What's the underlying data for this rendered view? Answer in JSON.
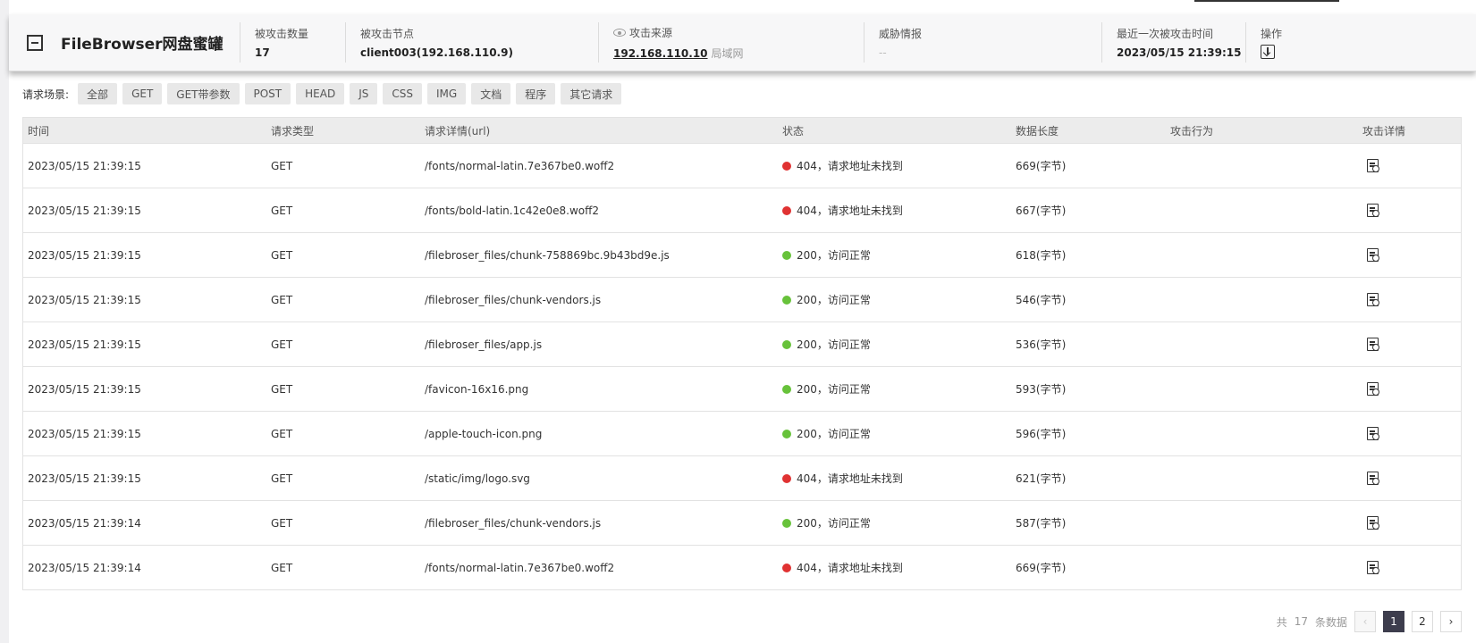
{
  "header": {
    "title": "FileBrowser网盘蜜罐",
    "stats": [
      {
        "label": "被攻击数量",
        "value": "17"
      },
      {
        "label": "被攻击节点",
        "value": "client003(192.168.110.9)"
      },
      {
        "label": "攻击来源",
        "value": "192.168.110.10",
        "extra": "局域网"
      },
      {
        "label": "威胁情报",
        "value": "--"
      },
      {
        "label": "最近一次被攻击时间",
        "value": "2023/05/15 21:39:15"
      },
      {
        "label": "操作"
      }
    ]
  },
  "filters": {
    "label": "请求场景:",
    "options": [
      "全部",
      "GET",
      "GET带参数",
      "POST",
      "HEAD",
      "JS",
      "CSS",
      "IMG",
      "文档",
      "程序",
      "其它请求"
    ]
  },
  "table": {
    "columns": [
      "时间",
      "请求类型",
      "请求详情(url)",
      "状态",
      "数据长度",
      "攻击行为",
      "攻击详情"
    ],
    "status_colors": {
      "error": "#e03232",
      "ok": "#67c23a"
    },
    "rows": [
      {
        "time": "2023/05/15 21:39:15",
        "method": "GET",
        "url": "/fonts/normal-latin.7e367be0.woff2",
        "status": "404，请求地址未找到",
        "status_type": "error",
        "length": "669(字节)",
        "behavior": ""
      },
      {
        "time": "2023/05/15 21:39:15",
        "method": "GET",
        "url": "/fonts/bold-latin.1c42e0e8.woff2",
        "status": "404，请求地址未找到",
        "status_type": "error",
        "length": "667(字节)",
        "behavior": ""
      },
      {
        "time": "2023/05/15 21:39:15",
        "method": "GET",
        "url": "/filebroser_files/chunk-758869bc.9b43bd9e.js",
        "status": "200，访问正常",
        "status_type": "ok",
        "length": "618(字节)",
        "behavior": ""
      },
      {
        "time": "2023/05/15 21:39:15",
        "method": "GET",
        "url": "/filebroser_files/chunk-vendors.js",
        "status": "200，访问正常",
        "status_type": "ok",
        "length": "546(字节)",
        "behavior": ""
      },
      {
        "time": "2023/05/15 21:39:15",
        "method": "GET",
        "url": "/filebroser_files/app.js",
        "status": "200，访问正常",
        "status_type": "ok",
        "length": "536(字节)",
        "behavior": ""
      },
      {
        "time": "2023/05/15 21:39:15",
        "method": "GET",
        "url": "/favicon-16x16.png",
        "status": "200，访问正常",
        "status_type": "ok",
        "length": "593(字节)",
        "behavior": ""
      },
      {
        "time": "2023/05/15 21:39:15",
        "method": "GET",
        "url": "/apple-touch-icon.png",
        "status": "200，访问正常",
        "status_type": "ok",
        "length": "596(字节)",
        "behavior": ""
      },
      {
        "time": "2023/05/15 21:39:15",
        "method": "GET",
        "url": "/static/img/logo.svg",
        "status": "404，请求地址未找到",
        "status_type": "error",
        "length": "621(字节)",
        "behavior": ""
      },
      {
        "time": "2023/05/15 21:39:14",
        "method": "GET",
        "url": "/filebroser_files/chunk-vendors.js",
        "status": "200，访问正常",
        "status_type": "ok",
        "length": "587(字节)",
        "behavior": ""
      },
      {
        "time": "2023/05/15 21:39:14",
        "method": "GET",
        "url": "/fonts/normal-latin.7e367be0.woff2",
        "status": "404，请求地址未找到",
        "status_type": "error",
        "length": "669(字节)",
        "behavior": ""
      }
    ]
  },
  "pagination": {
    "total_prefix": "共",
    "total": "17",
    "total_suffix": "条数据",
    "pages": [
      "1",
      "2"
    ],
    "current": "1",
    "prev_icon": "‹",
    "next_icon": "›"
  }
}
